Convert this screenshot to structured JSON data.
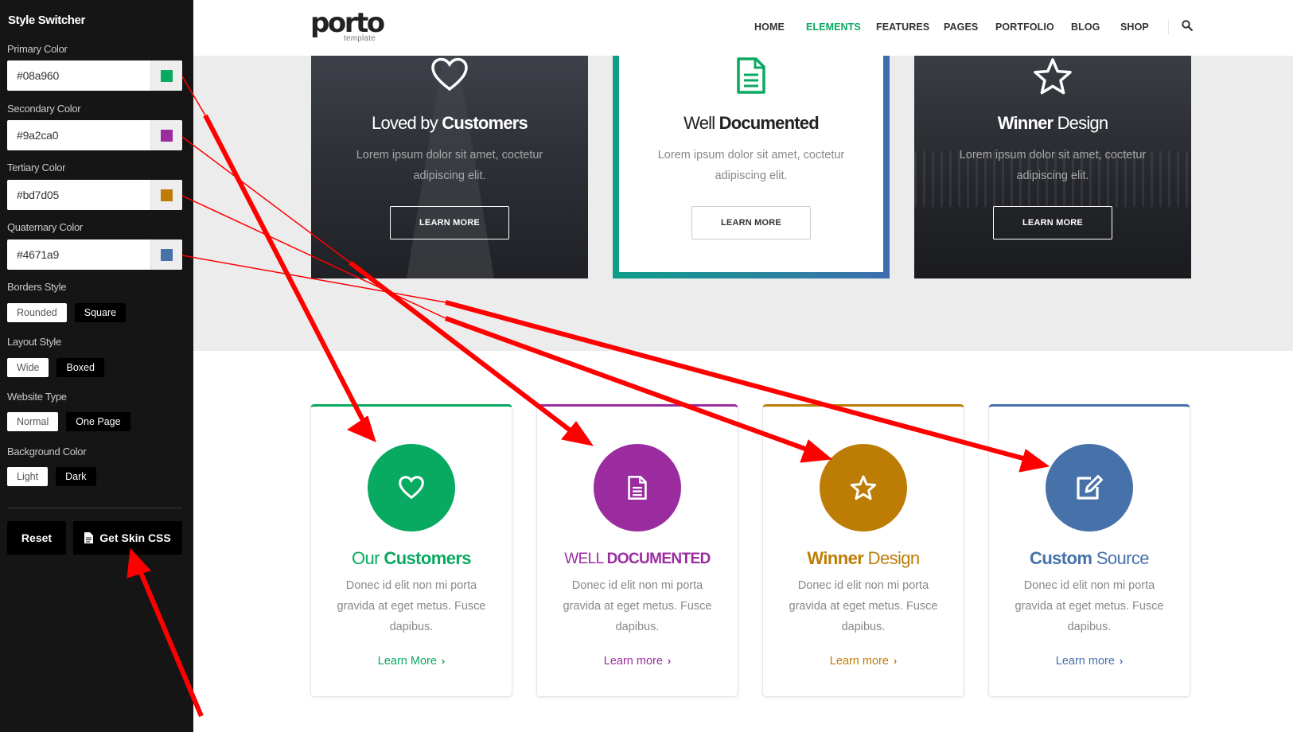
{
  "switcher": {
    "title": "Style Switcher",
    "colors": [
      {
        "label": "Primary Color",
        "value": "#08a960",
        "swatch": "#08a960"
      },
      {
        "label": "Secondary Color",
        "value": "#9a2ca0",
        "swatch": "#9a2ca0"
      },
      {
        "label": "Tertiary Color",
        "value": "#bd7d05",
        "swatch": "#bd7d05"
      },
      {
        "label": "Quaternary Color",
        "value": "#4671a9",
        "swatch": "#4671a9"
      }
    ],
    "borders": {
      "label": "Borders Style",
      "options": [
        "Rounded",
        "Square"
      ]
    },
    "layout": {
      "label": "Layout Style",
      "options": [
        "Wide",
        "Boxed"
      ]
    },
    "website_type": {
      "label": "Website Type",
      "options": [
        "Normal",
        "One Page"
      ]
    },
    "background": {
      "label": "Background Color",
      "options": [
        "Light",
        "Dark"
      ]
    },
    "reset_label": "Reset",
    "skin_label": "Get Skin CSS",
    "toggle_icon": "gears-icon"
  },
  "header": {
    "logo": "porto",
    "logo_sub": "template",
    "nav": [
      "HOME",
      "ELEMENTS",
      "FEATURES",
      "PAGES",
      "PORTFOLIO",
      "BLOG",
      "SHOP"
    ],
    "active_nav": "ELEMENTS",
    "search_icon": "search-icon"
  },
  "features": [
    {
      "title_light": "Loved by ",
      "title_bold": "Customers",
      "text": "Lorem ipsum dolor sit amet, coctetur adipiscing elit.",
      "button": "LEARN MORE",
      "icon": "heart-icon"
    },
    {
      "title_light": "Well ",
      "title_bold": "Documented",
      "text": "Lorem ipsum dolor sit amet, coctetur adipiscing elit.",
      "button": "LEARN MORE",
      "icon": "document-icon"
    },
    {
      "title_bold": "Winner",
      "title_light": " Design",
      "text": "Lorem ipsum dolor sit amet, coctetur adipiscing elit.",
      "button": "LEARN MORE",
      "icon": "star-icon"
    }
  ],
  "cards": [
    {
      "title_light": "Our ",
      "title_bold": "Customers",
      "text": "Donec id elit non mi porta gravida at eget metus. Fusce dapibus.",
      "link": "Learn More",
      "color": "#08a960",
      "icon": "heart-icon"
    },
    {
      "title_light": "WELL ",
      "title_bold": "DOCUMENTED",
      "text": "Donec id elit non mi porta gravida at eget metus. Fusce dapibus.",
      "link": "Learn more",
      "color": "#9a2ca0",
      "icon": "document-icon"
    },
    {
      "title_bold": "Winner",
      "title_light": " Design",
      "text": "Donec id elit non mi porta gravida at eget metus. Fusce dapibus.",
      "link": "Learn more",
      "color": "#bd7d05",
      "icon": "star-icon"
    },
    {
      "title_bold": "Custom",
      "title_light": " Source",
      "text": "Donec id elit non mi porta gravida at eget metus. Fusce dapibus.",
      "link": "Learn more",
      "color": "#4671a9",
      "icon": "edit-icon"
    }
  ],
  "colors": {
    "annotation": "#ff0000",
    "sidebar_bg": "#151515",
    "band_bg": "#ececec"
  }
}
